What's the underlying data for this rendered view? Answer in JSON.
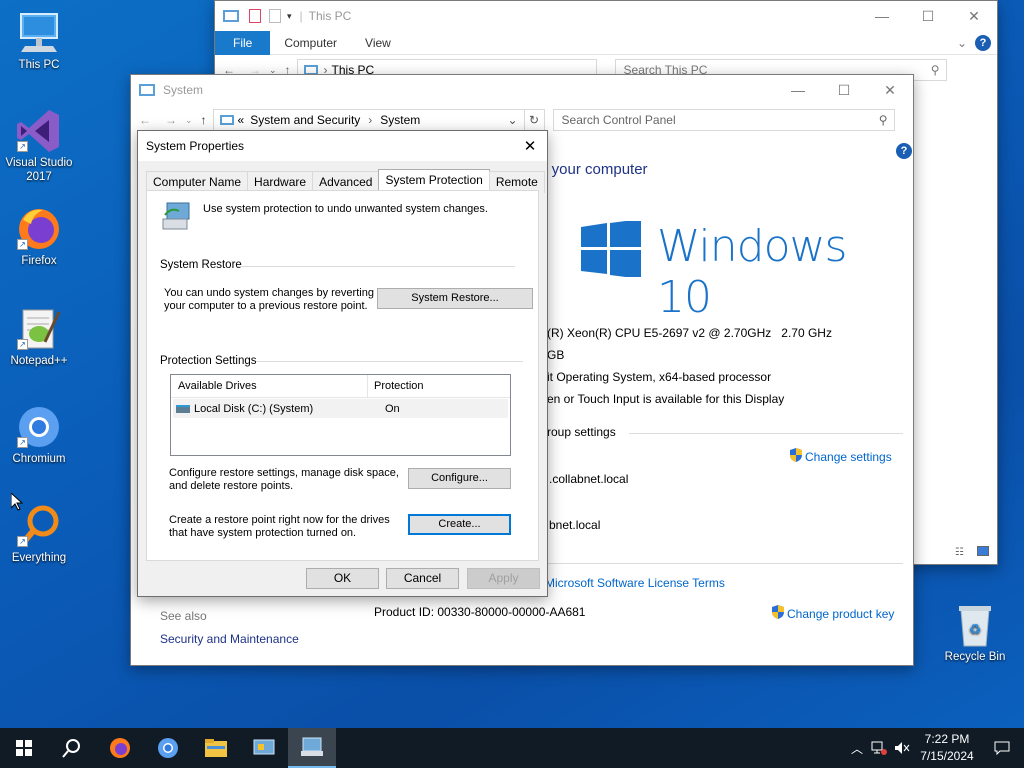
{
  "desktop": {
    "icons": [
      {
        "label": "This PC"
      },
      {
        "label": "Visual Studio 2017"
      },
      {
        "label": "Firefox"
      },
      {
        "label": "Notepad++"
      },
      {
        "label": "Chromium"
      },
      {
        "label": "Everything"
      },
      {
        "label": "Recycle Bin"
      }
    ]
  },
  "explorer": {
    "title": "This PC",
    "ribbon_tabs": [
      "File",
      "Computer",
      "View"
    ],
    "address": "This PC",
    "search_placeholder": "Search This PC"
  },
  "system_window": {
    "title": "System",
    "breadcrumb": {
      "prefix": "«",
      "items": [
        "System and Security",
        "System"
      ]
    },
    "search_placeholder": "Search Control Panel",
    "heading_partial": "it your computer",
    "brand": "Windows 10",
    "info": {
      "processor": "(R) Xeon(R) CPU E5-2697 v2 @ 2.70GHz   2.70 GHz",
      "ram": "GB",
      "system_type": "it Operating System, x64-based processor",
      "pen_touch": "en or Touch Input is available for this Display",
      "group_heading": "roup settings",
      "change_settings": "Change settings",
      "domain1": ".collabnet.local",
      "domain2": "bnet.local",
      "license_link": "Microsoft Software License Terms",
      "product_id": "Product ID: 00330-80000-00000-AA681",
      "change_product_key": "Change product key"
    },
    "see_also": {
      "heading": "See also",
      "link": "Security and Maintenance"
    }
  },
  "dialog": {
    "title": "System Properties",
    "tabs": [
      "Computer Name",
      "Hardware",
      "Advanced",
      "System Protection",
      "Remote"
    ],
    "active_tab": "System Protection",
    "intro": "Use system protection to undo unwanted system changes.",
    "restore_section": "System Restore",
    "restore_text": "You can undo system changes by reverting your computer to a previous restore point.",
    "restore_button": "System Restore...",
    "protection_section": "Protection Settings",
    "table": {
      "columns": [
        "Available Drives",
        "Protection"
      ],
      "rows": [
        {
          "drive": "Local Disk (C:) (System)",
          "protection": "On"
        }
      ]
    },
    "configure_text": "Configure restore settings, manage disk space, and delete restore points.",
    "configure_button": "Configure...",
    "create_text": "Create a restore point right now for the drives that have system protection turned on.",
    "create_button": "Create...",
    "ok": "OK",
    "cancel": "Cancel",
    "apply": "Apply"
  },
  "taskbar": {
    "time": "7:22 PM",
    "date": "7/15/2024"
  },
  "colors": {
    "accent": "#0078d7",
    "link": "#0066cc",
    "windows_blue": "#1a73c9",
    "desktop": "#0a5cb8",
    "taskbar": "#101b26"
  }
}
